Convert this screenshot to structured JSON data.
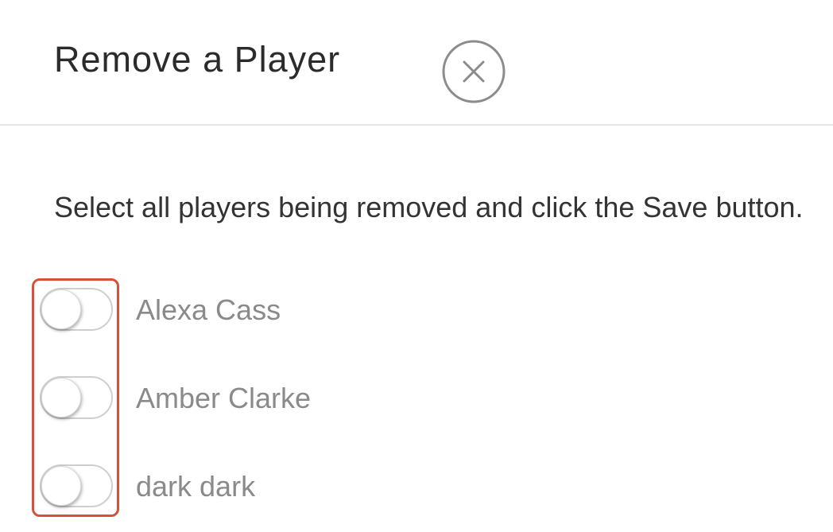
{
  "dialog": {
    "title": "Remove a Player",
    "close_icon": "close-circle-icon",
    "instructions": "Select all players being removed and click the Save button."
  },
  "players": [
    {
      "name": "Alexa Cass",
      "selected": false
    },
    {
      "name": "Amber Clarke",
      "selected": false
    },
    {
      "name": "dark dark",
      "selected": false
    }
  ],
  "colors": {
    "highlight": "#d9503a",
    "title_text": "#2b2b2b",
    "player_text": "#8a8a8a",
    "divider": "#e6e6e6"
  }
}
